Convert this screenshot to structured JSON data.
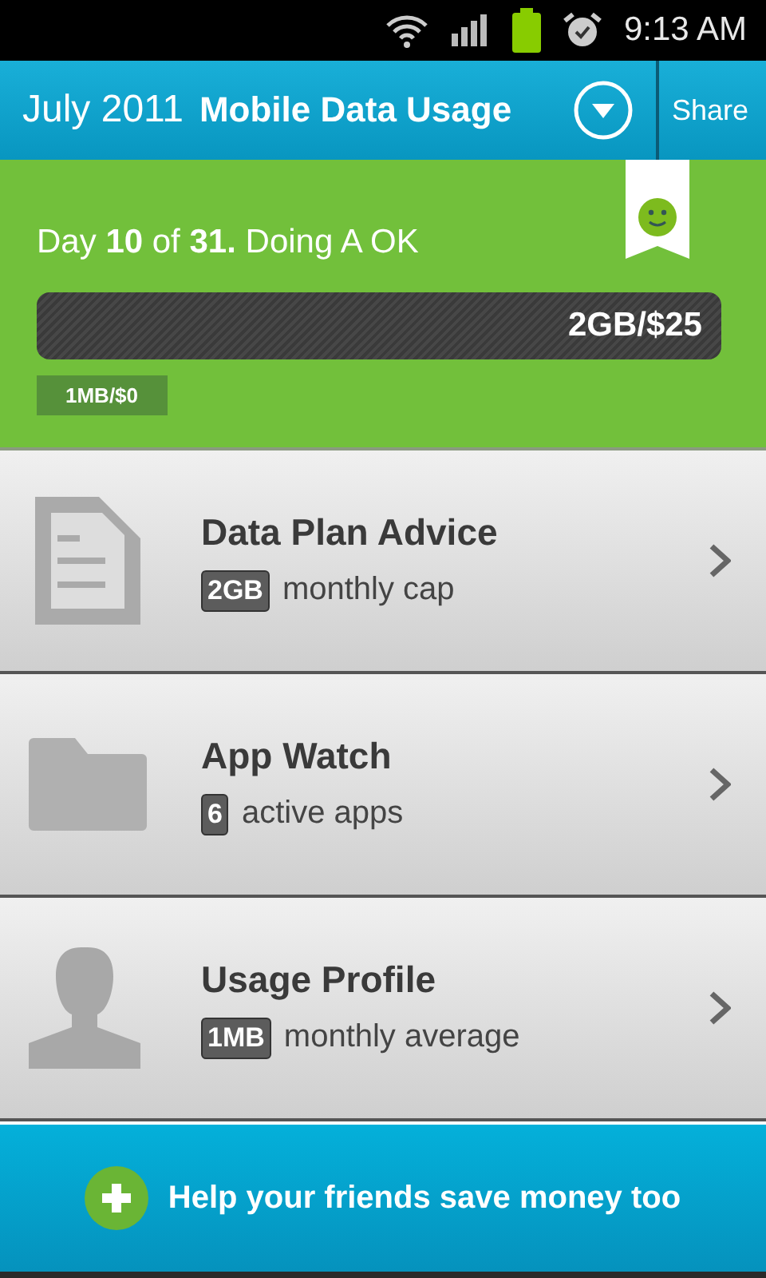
{
  "status_bar": {
    "time": "9:13 AM"
  },
  "header": {
    "month": "July 2011",
    "title": "Mobile Data Usage",
    "share": "Share"
  },
  "summary": {
    "text": "Day **10** of **31.** Doing A OK",
    "meter": {
      "cap": "2GB/$25",
      "used": "1MB/$0"
    }
  },
  "items": [
    {
      "kind": "document",
      "title": "Data Plan Advice",
      "badge": "2GB",
      "caption": "monthly cap"
    },
    {
      "kind": "folder",
      "title": "App Watch",
      "badge": "6",
      "caption": "active apps"
    },
    {
      "kind": "person",
      "title": "Usage Profile",
      "badge": "1MB",
      "caption": "monthly average"
    }
  ],
  "footer": {
    "label": "Help your friends save money too"
  }
}
